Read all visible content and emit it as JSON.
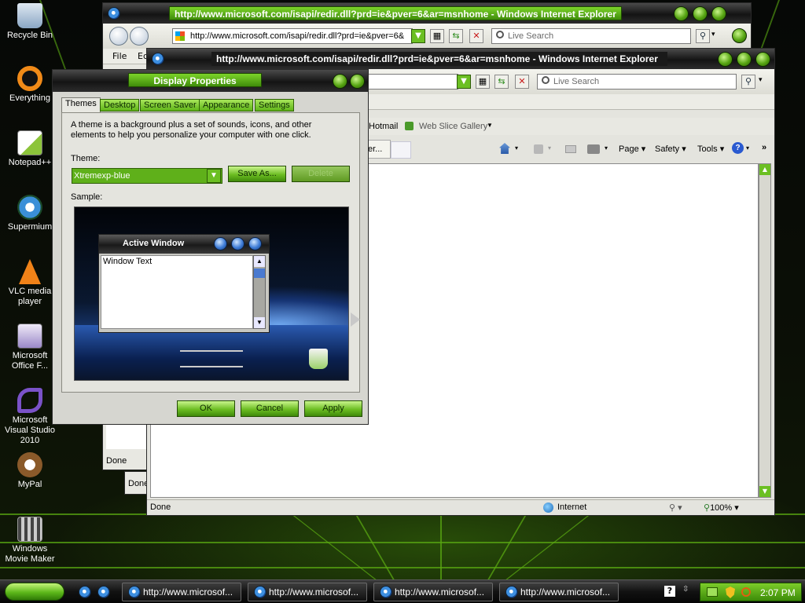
{
  "desktop": {
    "icons": [
      {
        "label": "Recycle Bin",
        "icon": "recycle-bin-icon"
      },
      {
        "label": "Everything",
        "icon": "everything-icon"
      },
      {
        "label": "Notepad++",
        "icon": "notepad-plus-plus-icon"
      },
      {
        "label": "Supermium",
        "icon": "supermium-icon"
      },
      {
        "label": "VLC media player",
        "icon": "vlc-icon"
      },
      {
        "label": "Microsoft Office F...",
        "icon": "office-icon"
      },
      {
        "label": "Microsoft Visual Studio 2010",
        "icon": "visual-studio-icon"
      },
      {
        "label": "MyPal",
        "icon": "mypal-icon"
      },
      {
        "label": "Windows Movie Maker",
        "icon": "movie-maker-icon"
      }
    ]
  },
  "ie_back": {
    "title": "http://www.microsoft.com/isapi/redir.dll?prd=ie&pver=6&ar=msnhome - Windows Internet Explorer",
    "address": "http://www.microsoft.com/isapi/redir.dll?prd=ie&pver=6&",
    "search_placeholder": "Live Search",
    "menu_file": "File",
    "menu_edit": "Ed",
    "status": "Done",
    "status2": "Done"
  },
  "ie_front": {
    "title": "http://www.microsoft.com/isapi/redir.dll?prd=ie&pver=6&ar=msnhome - Windows Internet Explorer",
    "search_placeholder": "Live Search",
    "favorites": [
      {
        "label": "Hotmail"
      },
      {
        "label": "Web Slice Gallery"
      }
    ],
    "tab_fragment": "er...",
    "commands": {
      "page": "Page",
      "safety": "Safety",
      "tools": "Tools"
    },
    "status": "Done",
    "zone": "Internet",
    "zoom": "100%"
  },
  "dialog": {
    "title": "Display Properties",
    "tabs": [
      "Themes",
      "Desktop",
      "Screen Saver",
      "Appearance",
      "Settings"
    ],
    "description": "A theme is a background plus a set of sounds, icons, and other elements to help you personalize your computer with one click.",
    "theme_label": "Theme:",
    "theme_value": "Xtremexp-blue",
    "save_as": "Save As...",
    "delete": "Delete",
    "sample_label": "Sample:",
    "sample": {
      "active_window": "Active Window",
      "window_text": "Window Text"
    },
    "ok": "OK",
    "cancel": "Cancel",
    "apply": "Apply"
  },
  "taskbar": {
    "tasks": [
      "http://www.microsof...",
      "http://www.microsof...",
      "http://www.microsof...",
      "http://www.microsof..."
    ],
    "clock": "2:07 PM"
  }
}
